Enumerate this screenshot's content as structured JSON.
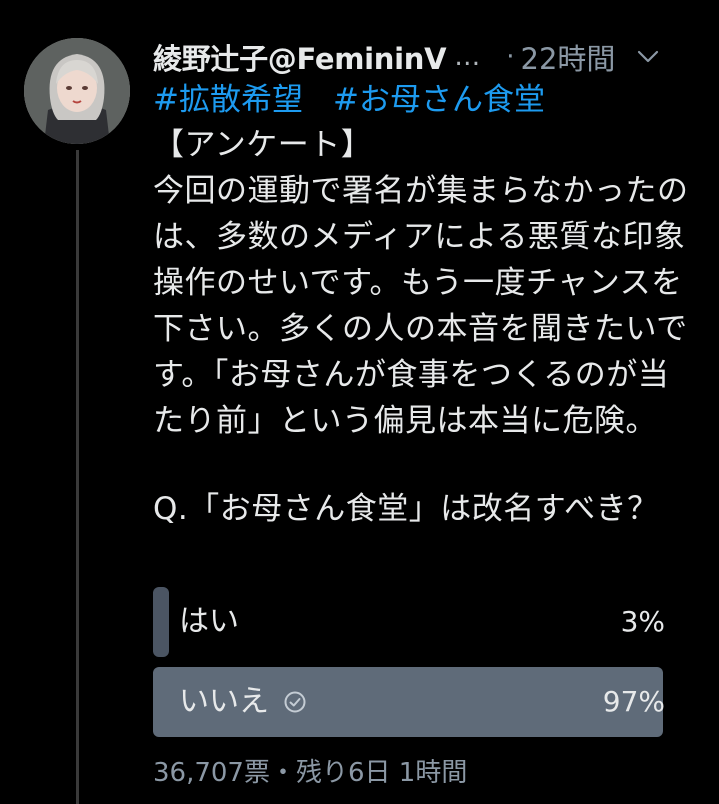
{
  "tweet": {
    "display_name": "綾野辻子@FemininV",
    "ellipsis": "…",
    "separator": "·",
    "time": "22時間",
    "more_icon": "chevron-down-icon",
    "hashtags": [
      "#拡散希望",
      "#お母さん食堂"
    ],
    "body": "【アンケート】\n今回の運動で署名が集まらなかったのは、多数のメディアによる悪質な印象操作のせいです。もう一度チャンスを下さい。多くの人の本音を聞きたいです。「お母さんが食事をつくるのが当たり前」という偏見は本当に危険。",
    "question": "Q.「お母さん食堂」は改名すべき？"
  },
  "poll": {
    "options": [
      {
        "label": "はい",
        "percent_text": "3%",
        "percent": 3,
        "selected": false
      },
      {
        "label": "いいえ",
        "percent_text": "97%",
        "percent": 97,
        "selected": true,
        "selected_icon": "check-circle-icon"
      }
    ],
    "votes": "36,707票",
    "dot": "・",
    "remaining": "残り6日 1時間"
  },
  "colors": {
    "background": "#000000",
    "text": "#e7e9ea",
    "secondary_text": "#8b98a5",
    "link": "#1d9bf0",
    "poll_bar": "#4b5563",
    "poll_bar_winner": "#5f6b79"
  }
}
